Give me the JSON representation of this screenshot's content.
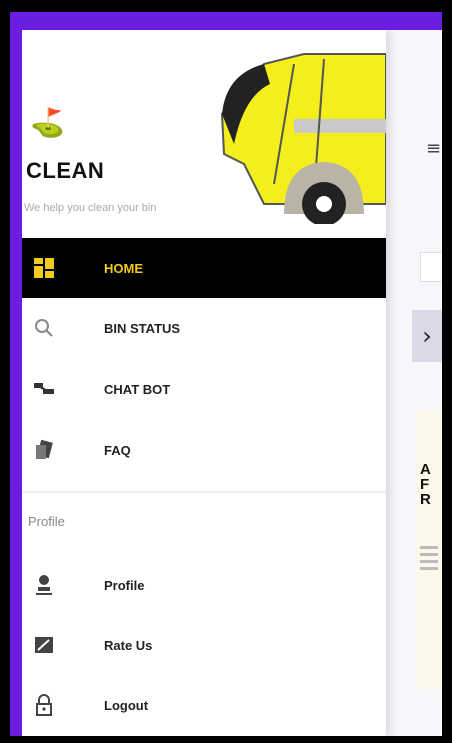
{
  "drawer": {
    "brand": "CLEAN",
    "tagline": "We help you clean your bin",
    "nav_items": [
      {
        "label": "HOME",
        "icon": "dashboard-icon",
        "active": true
      },
      {
        "label": "BIN STATUS",
        "icon": "search-icon",
        "active": false
      },
      {
        "label": "CHAT BOT",
        "icon": "chat-bot-icon",
        "active": false
      },
      {
        "label": "FAQ",
        "icon": "faq-icon",
        "active": false
      }
    ],
    "section_label": "Profile",
    "profile_items": [
      {
        "label": "Profile",
        "icon": "person-icon"
      },
      {
        "label": "Rate Us",
        "icon": "rate-icon"
      },
      {
        "label": "Logout",
        "icon": "lock-icon"
      }
    ]
  },
  "behind": {
    "card_title": "A\nF\nR"
  },
  "colors": {
    "frame": "#6a1fe0",
    "active_bg": "#000000",
    "active_text": "#f3c91a",
    "truck_yellow": "#f4ee1d"
  }
}
